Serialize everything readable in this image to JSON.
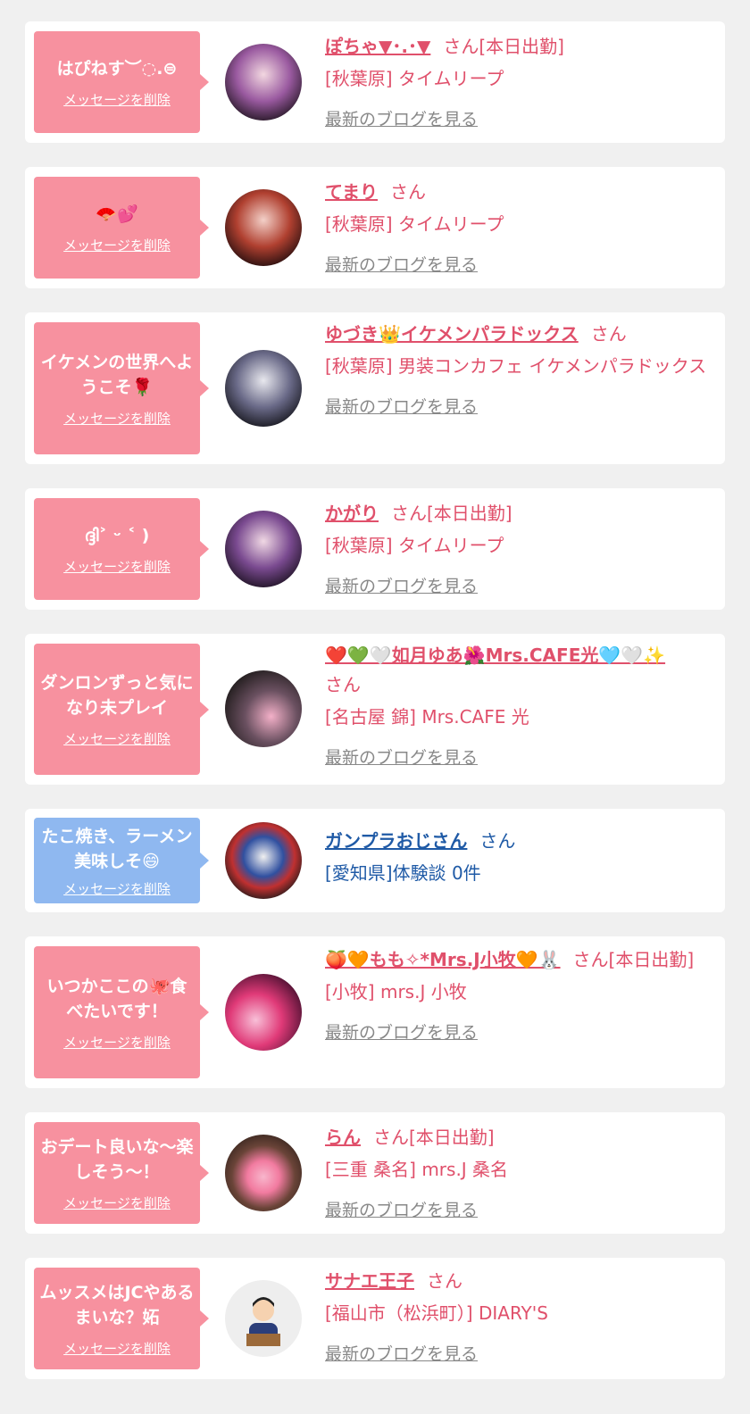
{
  "delete_label": "メッセージを削除",
  "blog_label": "最新のブログを見る",
  "san_label": "さん",
  "items": [
    {
      "message": "はぴねす︶◌.⊜",
      "name": "ぽちゃ▼･.･▼",
      "san_suffix": "さん[本日出勤]",
      "shop": "[秋葉原] タイムリープ"
    },
    {
      "message": "🪭💕",
      "name": "てまり",
      "san_suffix": "さん",
      "shop": "[秋葉原] タイムリープ"
    },
    {
      "message": "イケメンの世界へようこそ🌹",
      "name": "ゆづき👑イケメンパラドックス",
      "san_suffix": "さん",
      "shop": "[秋葉原] 男装コンカフェ イケメンパラドックス"
    },
    {
      "message": "ദ്ദി˃ ᵕ ˂ )",
      "name": "かがり",
      "san_suffix": "さん[本日出勤]",
      "shop": "[秋葉原] タイムリープ"
    },
    {
      "message": "ダンロンずっと気になり未プレイ",
      "name": "❤️💚🤍如月ゆあ🌺Mrs.CAFE光🩵🤍✨",
      "san_suffix": "さん",
      "shop": "[名古屋 錦] Mrs.CAFE 光"
    },
    {
      "message": "たこ焼き、ラーメン美味しそ😄",
      "name": "ガンプラおじさん",
      "san_suffix": "さん",
      "shop": "[愛知県]体験談 0件"
    },
    {
      "message": "いつかここの🐙食べたいです！",
      "name": "🍑🧡もも✧*Mrs.J小牧🧡🐰",
      "san_suffix": "さん[本日出勤]",
      "shop": "[小牧] mrs.J 小牧"
    },
    {
      "message": "おデート良いな〜楽しそう〜！",
      "name": "らん",
      "san_suffix": "さん[本日出勤]",
      "shop": "[三重 桑名] mrs.J 桑名"
    },
    {
      "message": "ムッスメはJCやあるまいな？妬",
      "name": "サナエ王子",
      "san_suffix": "さん",
      "shop": "[福山市（松浜町）] DIARY'S"
    }
  ],
  "colors": {
    "pink_bubble": "#f7919f",
    "blue_bubble": "#8fb8f0",
    "pink_text": "#e0506b",
    "blue_text": "#1f5aa6",
    "gray_link": "#888888",
    "background": "#f0f0f0"
  }
}
